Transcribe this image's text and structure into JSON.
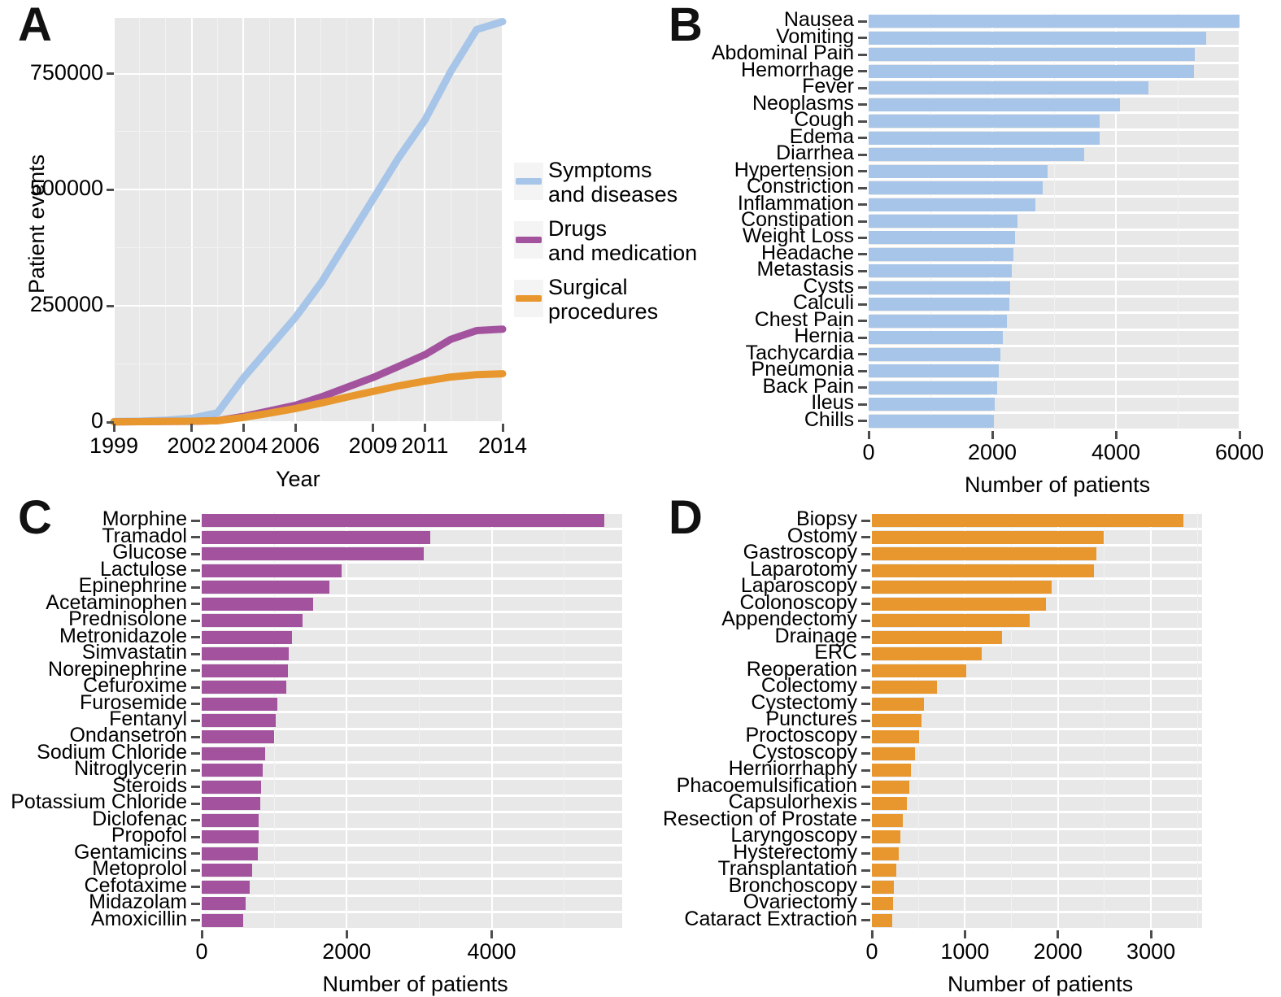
{
  "figure": {
    "panels": [
      {
        "letter": "A"
      },
      {
        "letter": "B"
      },
      {
        "letter": "C"
      },
      {
        "letter": "D"
      }
    ]
  },
  "colors": {
    "symptoms_blue": "#a6c5e8",
    "drugs_purple": "#a3539e",
    "surgical_orange": "#e8972e",
    "panel_background": "#e8e8e8",
    "grid_white": "#ffffff"
  },
  "chart_data": [
    {
      "panel": "A",
      "type": "line",
      "title": "",
      "xlabel": "Year",
      "ylabel": "Patient events",
      "xticks": [
        "1999",
        "2002",
        "2004",
        "2006",
        "2009",
        "2011",
        "2014"
      ],
      "yticks": [
        "0",
        "250000",
        "500000",
        "750000"
      ],
      "xlim": [
        1999,
        2014
      ],
      "ylim": [
        0,
        870000
      ],
      "grid": true,
      "legend_position": "right",
      "x": [
        1999,
        2000,
        2001,
        2002,
        2003,
        2004,
        2005,
        2006,
        2007,
        2008,
        2009,
        2010,
        2011,
        2012,
        2013,
        2014
      ],
      "series": [
        {
          "name": "Symptoms and diseases",
          "color": "#a6c5e8",
          "values": [
            1000,
            2000,
            4000,
            8000,
            20000,
            95000,
            160000,
            225000,
            300000,
            390000,
            480000,
            570000,
            650000,
            755000,
            845000,
            862000
          ]
        },
        {
          "name": "Drugs and medication",
          "color": "#a3539e",
          "values": [
            500,
            800,
            1200,
            1600,
            3000,
            12000,
            24000,
            36000,
            54000,
            75000,
            96000,
            120000,
            145000,
            178000,
            197000,
            200000
          ]
        },
        {
          "name": "Surgical procedures",
          "color": "#e8972e",
          "values": [
            600,
            900,
            1300,
            1700,
            2800,
            10000,
            19000,
            29000,
            41000,
            54000,
            66000,
            78000,
            88000,
            97000,
            102000,
            104000
          ]
        }
      ],
      "legend_entries": [
        {
          "label_line1": "Symptoms",
          "label_line2": "and diseases",
          "color": "#a6c5e8"
        },
        {
          "label_line1": "Drugs",
          "label_line2": "and medication",
          "color": "#a3539e"
        },
        {
          "label_line1": "Surgical",
          "label_line2": "procedures",
          "color": "#e8972e"
        }
      ]
    },
    {
      "panel": "B",
      "type": "bar",
      "orientation": "horizontal",
      "title": "",
      "xlabel": "Number of patients",
      "ylabel": "",
      "xticks": [
        "0",
        "2000",
        "4000",
        "6000"
      ],
      "xlim": [
        0,
        6000
      ],
      "grid": true,
      "color": "#a6c5e8",
      "categories": [
        "Nausea",
        "Vomiting",
        "Abdominal Pain",
        "Hemorrhage",
        "Fever",
        "Neoplasms",
        "Cough",
        "Edema",
        "Diarrhea",
        "Hypertension",
        "Constriction",
        "Inflammation",
        "Constipation",
        "Weight Loss",
        "Headache",
        "Metastasis",
        "Cysts",
        "Calculi",
        "Chest Pain",
        "Hernia",
        "Tachycardia",
        "Pneumonia",
        "Back Pain",
        "Ileus",
        "Chills"
      ],
      "values": [
        6000,
        5460,
        5270,
        5260,
        4530,
        4070,
        3740,
        3740,
        3490,
        2890,
        2820,
        2700,
        2410,
        2370,
        2340,
        2320,
        2290,
        2280,
        2240,
        2170,
        2130,
        2110,
        2080,
        2040,
        2020
      ]
    },
    {
      "panel": "C",
      "type": "bar",
      "orientation": "horizontal",
      "title": "",
      "xlabel": "Number of patients",
      "ylabel": "",
      "xticks": [
        "0",
        "2000",
        "4000"
      ],
      "xlim": [
        0,
        5800
      ],
      "grid": true,
      "color": "#a3539e",
      "categories": [
        "Morphine",
        "Tramadol",
        "Glucose",
        "Lactulose",
        "Epinephrine",
        "Acetaminophen",
        "Prednisolone",
        "Metronidazole",
        "Simvastatin",
        "Norepinephrine",
        "Cefuroxime",
        "Furosemide",
        "Fentanyl",
        "Ondansetron",
        "Sodium Chloride",
        "Nitroglycerin",
        "Steroids",
        "Potassium Chloride",
        "Diclofenac",
        "Propofol",
        "Gentamicins",
        "Metoprolol",
        "Cefotaxime",
        "Midazolam",
        "Amoxicillin"
      ],
      "values": [
        5550,
        3150,
        3060,
        1930,
        1760,
        1540,
        1390,
        1240,
        1200,
        1190,
        1170,
        1040,
        1020,
        1000,
        880,
        840,
        820,
        810,
        790,
        780,
        770,
        700,
        660,
        610,
        570
      ]
    },
    {
      "panel": "D",
      "type": "bar",
      "orientation": "horizontal",
      "title": "",
      "xlabel": "Number of patients",
      "ylabel": "",
      "xticks": [
        "0",
        "1000",
        "2000",
        "3000"
      ],
      "xlim": [
        0,
        3550
      ],
      "grid": true,
      "color": "#e8972e",
      "categories": [
        "Biopsy",
        "Ostomy",
        "Gastroscopy",
        "Laparotomy",
        "Laparoscopy",
        "Colonoscopy",
        "Appendectomy",
        "Drainage",
        "ERC",
        "Reoperation",
        "Colectomy",
        "Cystectomy",
        "Punctures",
        "Proctoscopy",
        "Cystoscopy",
        "Herniorrhaphy",
        "Phacoemulsification",
        "Capsulorhexis",
        "Resection of Prostate",
        "Laryngoscopy",
        "Hysterectomy",
        "Transplantation",
        "Bronchoscopy",
        "Ovariectomy",
        "Cataract Extraction"
      ],
      "values": [
        3350,
        2490,
        2410,
        2390,
        1930,
        1870,
        1700,
        1400,
        1180,
        1010,
        700,
        560,
        530,
        510,
        460,
        420,
        400,
        380,
        330,
        310,
        290,
        260,
        240,
        230,
        220
      ]
    }
  ]
}
